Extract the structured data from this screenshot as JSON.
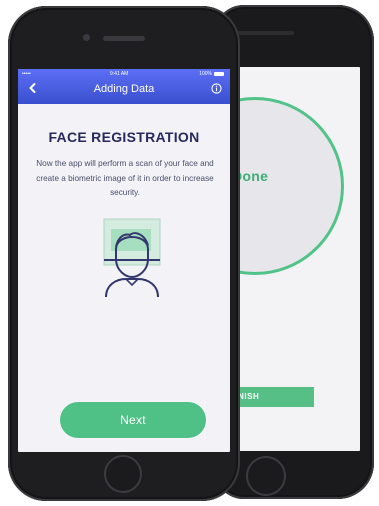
{
  "back_screen": {
    "done_label": "Done",
    "finish_label": "FINISH"
  },
  "front_screen": {
    "status_bar": {
      "signal": "•••••",
      "time": "9:41 AM",
      "battery": "100%"
    },
    "nav": {
      "title": "Adding Data"
    },
    "heading": "FACE REGISTRATION",
    "description": "Now the app will perform a scan of your face and create a biometric image of it in order to increase security.",
    "next_button": "Next"
  },
  "colors": {
    "accent_green": "#4fc186",
    "header_blue": "#3a4fcf",
    "heading_navy": "#27295e"
  }
}
